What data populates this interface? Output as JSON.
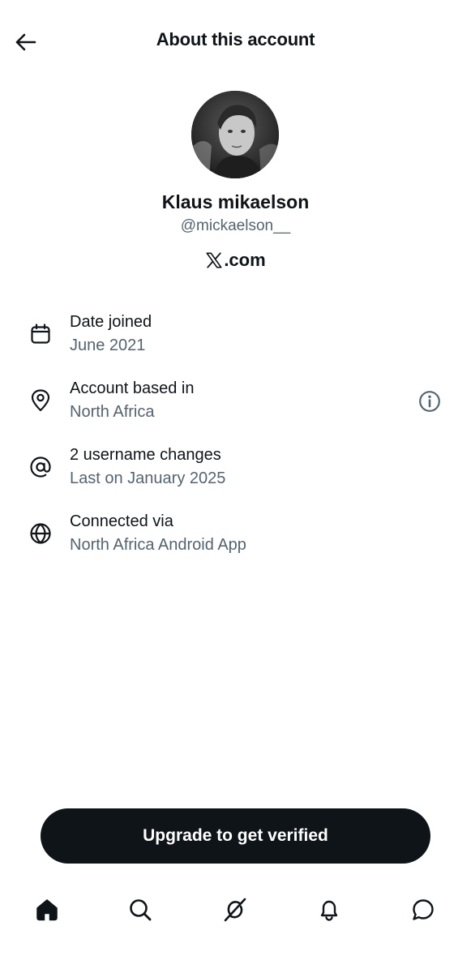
{
  "header": {
    "title": "About this account",
    "back_icon": "arrow-left-icon"
  },
  "profile": {
    "display_name": "Klaus mikaelson",
    "handle": "@mickaelson__",
    "site_logo": "x-logo-icon",
    "site_domain": ".com"
  },
  "details": [
    {
      "icon": "calendar-icon",
      "title": "Date joined",
      "value": "June 2021"
    },
    {
      "icon": "location-pin-icon",
      "title": "Account based in",
      "value": "North Africa",
      "extra_icon": "info-icon"
    },
    {
      "icon": "at-sign-icon",
      "title": "2 username changes",
      "value": "Last on January 2025"
    },
    {
      "icon": "globe-icon",
      "title": "Connected via",
      "value": "North Africa Android App"
    }
  ],
  "cta": {
    "label": "Upgrade to get verified"
  },
  "bottom_nav": {
    "items": [
      {
        "icon": "home-icon",
        "active": true
      },
      {
        "icon": "search-icon",
        "active": false
      },
      {
        "icon": "grok-icon",
        "active": false
      },
      {
        "icon": "bell-icon",
        "active": false
      },
      {
        "icon": "messages-icon",
        "active": false
      }
    ]
  },
  "colors": {
    "text_primary": "#0f1419",
    "text_secondary": "#536471",
    "button_bg": "#0f1419",
    "background": "#ffffff"
  }
}
